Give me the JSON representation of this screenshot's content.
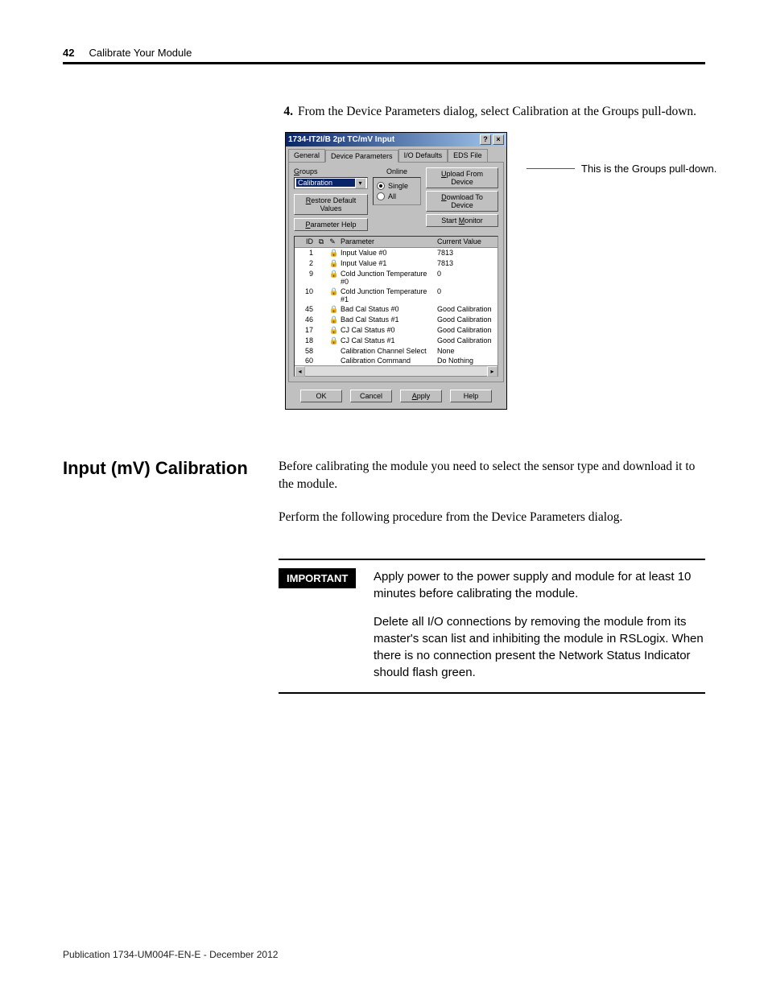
{
  "header": {
    "page_no": "42",
    "chapter": "Calibrate Your Module"
  },
  "step": {
    "num": "4.",
    "text": "From the Device Parameters dialog, select Calibration at the Groups pull-down."
  },
  "annotation": "This is the Groups pull-down.",
  "dialog": {
    "title": "1734-IT2I/B 2pt TC/mV Input",
    "tabs": {
      "general": "General",
      "device_params": "Device Parameters",
      "io_defaults": "I/O Defaults",
      "eds_file": "EDS File"
    },
    "groups_label": "Groups",
    "groups_value": "Calibration",
    "online_label": "Online",
    "restore_btn": "Restore Default Values",
    "param_help_btn": "Parameter Help",
    "radio_single": "Single",
    "radio_all": "All",
    "upload_btn": "Upload From Device",
    "download_btn": "Download To Device",
    "monitor_btn": "Start Monitor",
    "cols": {
      "id": "ID",
      "parameter": "Parameter",
      "value": "Current Value"
    },
    "rows": [
      {
        "id": "1",
        "lock": true,
        "param": "Input Value #0",
        "val": "7813"
      },
      {
        "id": "2",
        "lock": true,
        "param": "Input Value #1",
        "val": "7813"
      },
      {
        "id": "9",
        "lock": true,
        "param": "Cold Junction Temperature #0",
        "val": "0"
      },
      {
        "id": "10",
        "lock": true,
        "param": "Cold Junction Temperature #1",
        "val": "0"
      },
      {
        "id": "45",
        "lock": true,
        "param": "Bad Cal Status #0",
        "val": "Good Calibration"
      },
      {
        "id": "46",
        "lock": true,
        "param": "Bad Cal Status #1",
        "val": "Good Calibration"
      },
      {
        "id": "17",
        "lock": true,
        "param": "CJ Cal Status #0",
        "val": "Good Calibration"
      },
      {
        "id": "18",
        "lock": true,
        "param": "CJ Cal Status #1",
        "val": "Good Calibration"
      },
      {
        "id": "58",
        "lock": false,
        "param": "Calibration Channel Select",
        "val": "None"
      },
      {
        "id": "60",
        "lock": false,
        "param": "Calibration Command",
        "val": "Do Nothing"
      }
    ],
    "buttons": {
      "ok": "OK",
      "cancel": "Cancel",
      "apply": "Apply",
      "help": "Help"
    }
  },
  "section": {
    "heading": "Input (mV) Calibration",
    "para1": "Before calibrating the module you need to select the sensor type and download it to the module.",
    "para2": "Perform the following procedure from the Device Parameters dialog."
  },
  "important": {
    "badge": "IMPORTANT",
    "p1": "Apply power to the power supply and module for at least 10 minutes before calibrating the module.",
    "p2": "Delete all I/O connections by removing the module from its master's scan list and inhibiting the module in RSLogix. When there is no connection present the Network Status Indicator should flash green."
  },
  "footer": "Publication 1734-UM004F-EN-E - December 2012"
}
